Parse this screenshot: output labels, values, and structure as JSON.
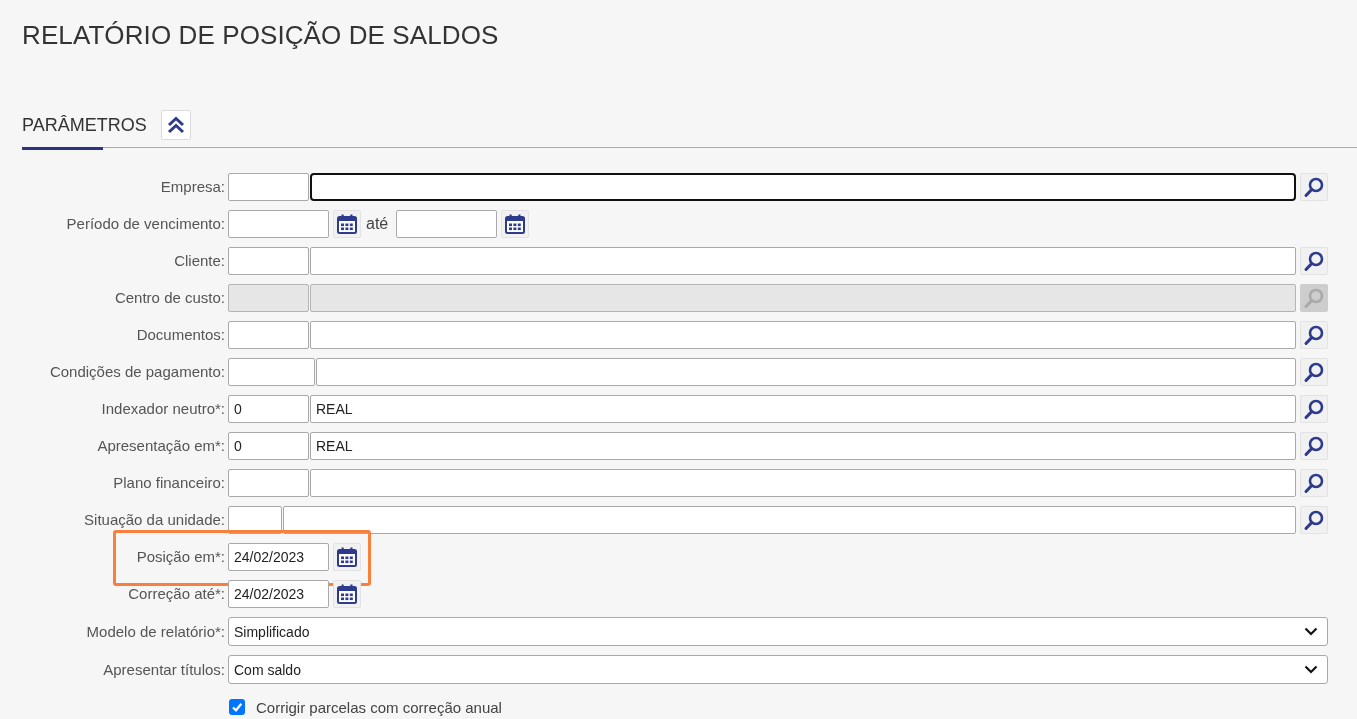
{
  "page_title": "RELATÓRIO DE POSIÇÃO DE SALDOS",
  "section": {
    "title": "PARÂMETROS",
    "expanded": true
  },
  "fields": [
    {
      "kind": "lookup",
      "label": "Empresa:",
      "focused": true,
      "disabled": false,
      "highlighted": false
    },
    {
      "kind": "date_range",
      "label": "Período de vencimento:",
      "separator": "até",
      "highlighted": false
    },
    {
      "kind": "lookup",
      "label": "Cliente:",
      "focused": false,
      "disabled": false,
      "highlighted": false
    },
    {
      "kind": "lookup",
      "label": "Centro de custo:",
      "focused": false,
      "disabled": true,
      "highlighted": false
    },
    {
      "kind": "lookup",
      "label": "Documentos:",
      "focused": false,
      "disabled": false,
      "highlighted": false
    },
    {
      "kind": "lookup",
      "label": "Condições de pagamento:",
      "focused": false,
      "disabled": false,
      "highlighted": false
    },
    {
      "kind": "lookup",
      "label": "Indexador neutro*:",
      "code": "0",
      "description": "REAL",
      "focused": false,
      "disabled": false,
      "highlighted": false
    },
    {
      "kind": "lookup",
      "label": "Apresentação em*:",
      "code": "0",
      "description": "REAL",
      "focused": false,
      "disabled": false,
      "highlighted": false
    },
    {
      "kind": "lookup",
      "label": "Plano financeiro:",
      "focused": false,
      "disabled": false,
      "highlighted": false
    },
    {
      "kind": "lookup",
      "label": "Situação da unidade:",
      "focused": false,
      "disabled": false,
      "highlighted": false
    },
    {
      "kind": "date",
      "label": "Posição em*:",
      "value": "24/02/2023",
      "highlighted": true
    },
    {
      "kind": "date",
      "label": "Correção até*:",
      "value": "24/02/2023",
      "highlighted": false
    },
    {
      "kind": "select",
      "label": "Modelo de relatório*:",
      "value": "Simplificado",
      "highlighted": false
    },
    {
      "kind": "select",
      "label": "Apresentar títulos:",
      "value": "Com saldo",
      "highlighted": false
    },
    {
      "kind": "checkbox",
      "label": "Corrigir parcelas com correção anual",
      "checked": true,
      "highlighted": false
    }
  ]
}
